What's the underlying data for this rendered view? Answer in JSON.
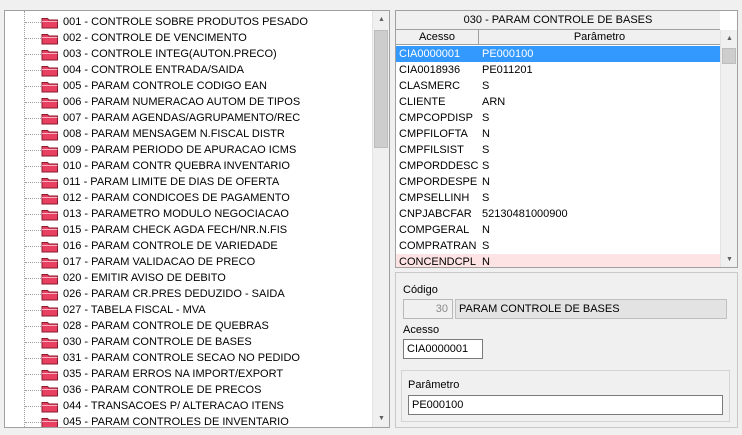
{
  "tree": {
    "items": [
      "001 - CONTROLE SOBRE PRODUTOS PESADO",
      "002 - CONTROLE DE VENCIMENTO",
      "003 - CONTROLE INTEG(AUTON.PRECO)",
      "004 - CONTROLE ENTRADA/SAIDA",
      "005 - PARAM CONTROLE CODIGO EAN",
      "006 - PARAM NUMERACAO AUTOM DE TIPOS",
      "007 - PARAM AGENDAS/AGRUPAMENTO/REC",
      "008 - PARAM MENSAGEM N.FISCAL DISTR",
      "009 - PARAM PERIODO DE APURACAO ICMS",
      "010 - PARAM CONTR QUEBRA INVENTARIO",
      "011 - PARAM LIMITE DE DIAS DE OFERTA",
      "012 - PARAM CONDICOES DE PAGAMENTO",
      "013 - PARAMETRO MODULO NEGOCIACAO",
      "015 - PARAM CHECK AGDA FECH/NR.N.FIS",
      "016 - PARAM CONTROLE DE VARIEDADE",
      "017 - PARAM VALIDACAO DE PRECO",
      "020 - EMITIR AVISO DE DEBITO",
      "026 - PARAM CR.PRES DEDUZIDO - SAIDA",
      "027 - TABELA FISCAL - MVA",
      "028 - PARAM CONTROLE DE QUEBRAS",
      "030 - PARAM CONTROLE DE BASES",
      "031 - PARAM CONTROLE SECAO NO PEDIDO",
      "035 - PARAM ERROS NA IMPORT/EXPORT",
      "036 - PARAM CONTROLE DE PRECOS",
      "044 - TRANSACOES P/ ALTERACAO ITENS",
      "045 - PARAM CONTROLES DE INVENTARIO"
    ]
  },
  "grid": {
    "title": "030 - PARAM CONTROLE DE BASES",
    "headers": {
      "acesso": "Acesso",
      "parametro": "Parâmetro"
    },
    "rows": [
      {
        "acesso": "CIA0000001",
        "parametro": "PE000100"
      },
      {
        "acesso": "CIA0018936",
        "parametro": "PE011201"
      },
      {
        "acesso": "CLASMERC",
        "parametro": "S"
      },
      {
        "acesso": "CLIENTE",
        "parametro": "ARN"
      },
      {
        "acesso": "CMPCOPDISP",
        "parametro": "S"
      },
      {
        "acesso": "CMPFILOFTA",
        "parametro": "N"
      },
      {
        "acesso": "CMPFILSIST",
        "parametro": "S"
      },
      {
        "acesso": "CMPORDDESC",
        "parametro": "S"
      },
      {
        "acesso": "CMPORDESPE",
        "parametro": "N"
      },
      {
        "acesso": "CMPSELLINH",
        "parametro": "S"
      },
      {
        "acesso": "CNPJABCFAR",
        "parametro": "52130481000900"
      },
      {
        "acesso": "COMPGERAL",
        "parametro": "N"
      },
      {
        "acesso": "COMPRATRAN",
        "parametro": "S"
      },
      {
        "acesso": "CONCENDCPL",
        "parametro": "N"
      }
    ]
  },
  "form": {
    "codigo_label": "Código",
    "codigo_value": "30",
    "codigo_desc": "PARAM CONTROLE DE BASES",
    "acesso_label": "Acesso",
    "acesso_value": "CIA0000001",
    "parametro_label": "Parâmetro",
    "parametro_value": "PE000100"
  },
  "colors": {
    "selection": "#3399ff",
    "folder": "#e84060",
    "last_row_tint": "#fde3e3"
  },
  "icons": {
    "tree_item": "folder-icon",
    "scroll_up": "arrow-up-icon",
    "scroll_down": "arrow-down-icon"
  }
}
